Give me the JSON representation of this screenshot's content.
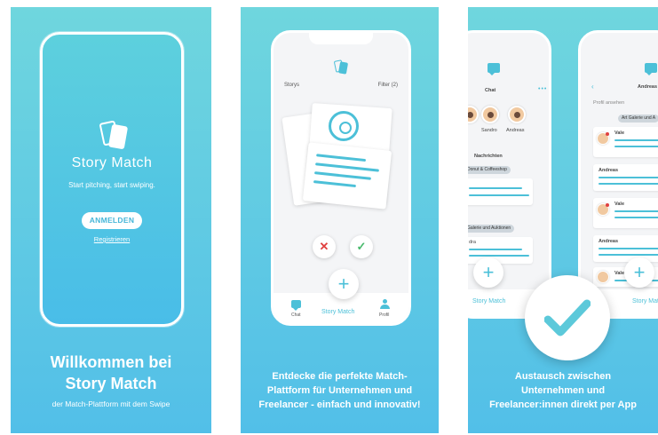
{
  "panel1": {
    "brand": "Story Match",
    "tagline": "Start pitching, start swiping.",
    "login_button": "ANMELDEN",
    "register_link": "Registrieren",
    "caption_line1": "Willkommen bei",
    "caption_line2": "Story Match",
    "subcaption": "der Match-Plattform mit dem Swipe"
  },
  "panel2": {
    "stories_label": "Storys",
    "filter_label": "Filter (2)",
    "reject_symbol": "✕",
    "accept_symbol": "✓",
    "add_symbol": "+",
    "nav_chat": "Chat",
    "nav_brand": "Story Match",
    "nav_profile": "Profil",
    "caption_line1": "Entdecke die perfekte Match-",
    "caption_line2": "Plattform für Unternehmen und",
    "caption_line3": "Freelancer - einfach und innovativ!"
  },
  "panel3": {
    "chat_title": "Chat",
    "contact1": "Sandro",
    "contact2": "Andreas",
    "messages_header": "Nachrichten",
    "group1": "Donut & Coffeeshop",
    "group2": "Galerie und Auktionen",
    "sender_dra": "dra",
    "detail_title": "Andreas",
    "profile_link": "Profil ansehen",
    "detail_group": "Art Galerie und A",
    "msg_vale": "Vale",
    "msg_andreas": "Andreas",
    "add_symbol": "+",
    "nav_brand": "Story Match",
    "caption_line1": "Austausch zwischen",
    "caption_line2": "Unternehmen und",
    "caption_line3": "Freelancer:innen direkt per App"
  },
  "colors": {
    "accent": "#4cc0d8",
    "reject": "#e0403f",
    "accept": "#47b96b"
  }
}
